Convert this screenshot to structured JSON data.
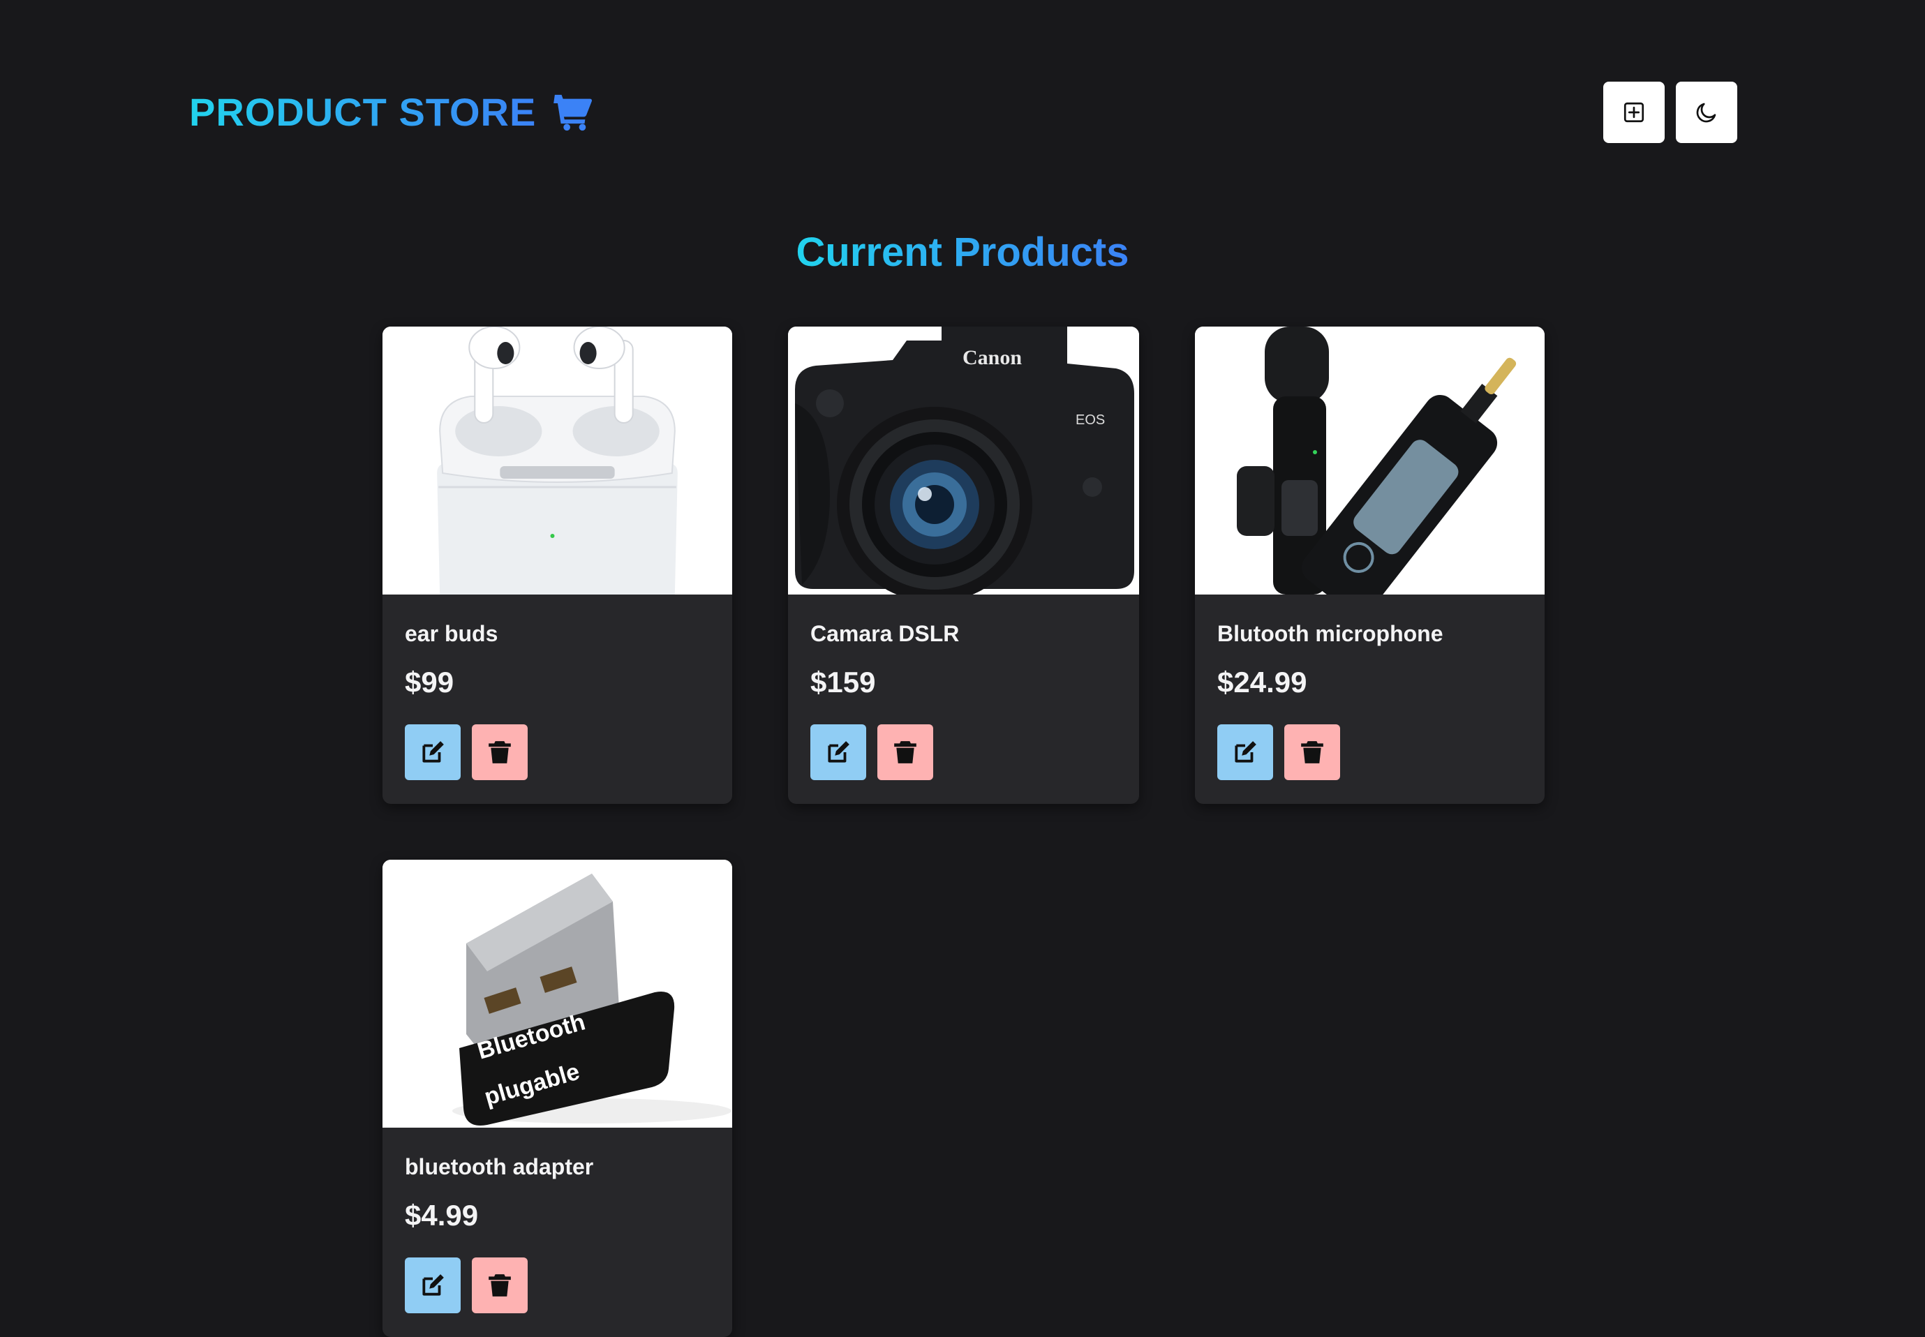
{
  "header": {
    "brand_text": "PRODUCT STORE",
    "brand_icon": "shopping-cart-icon",
    "create_icon": "plus-square-icon",
    "theme_icon": "moon-icon"
  },
  "main": {
    "title": "Current Products"
  },
  "products": [
    {
      "name": "ear buds",
      "price": "$99",
      "image": "earbuds"
    },
    {
      "name": "Camara DSLR",
      "price": "$159",
      "image": "camera"
    },
    {
      "name": "Blutooth microphone",
      "price": "$24.99",
      "image": "microphone"
    },
    {
      "name": "bluetooth adapter",
      "price": "$4.99",
      "image": "adapter"
    }
  ],
  "image_text": {
    "camera_brand": "Canon",
    "camera_model": "EOS",
    "adapter_label": "Bluetooth",
    "adapter_brand": "plugable"
  },
  "colors": {
    "background": "#18181b",
    "card": "#27272a",
    "accent_start": "#22d3ee",
    "accent_end": "#3b82f6",
    "edit_button": "#90cdf4",
    "delete_button": "#feb2b2"
  }
}
